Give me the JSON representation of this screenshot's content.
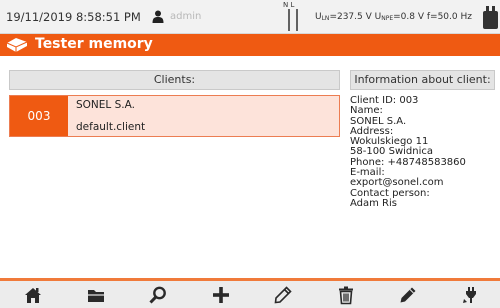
{
  "status": {
    "datetime": "19/11/2019 8:58:51 PM",
    "user": "admin",
    "nl_labels": "N L",
    "measurement": "Uₗₙ=237.5 V Uₙₚₑ=0.8 V f=50.0 Hz",
    "un_label": "U",
    "un_sub": "LN",
    "un_value": "=237.5 V ",
    "upe_label": "U",
    "upe_sub": "NPE",
    "upe_value": "=0.8 V ",
    "freq": "f=50.0 Hz"
  },
  "title": "Tester memory",
  "clients_header": "Clients:",
  "info_header": "Information about client:",
  "client": {
    "number": "003",
    "name": "SONEL S.A.",
    "file": "default.client"
  },
  "info_lines": [
    "Client ID: 003",
    "Name:",
    "SONEL S.A.",
    "Address:",
    "Wokulskiego 11",
    "58-100 Swidnica",
    "Phone: +48748583860",
    "E-mail:",
    "export@sonel.com",
    "Contact person:",
    "Adam Ris"
  ],
  "toolbar": [
    "home-icon",
    "folder-icon",
    "search-icon",
    "add-icon",
    "edit-icon",
    "delete-icon",
    "edit-pen-icon",
    "plug-edit-icon"
  ],
  "colors": {
    "accent": "#ef5a12",
    "selected_row": "#fde3da"
  }
}
